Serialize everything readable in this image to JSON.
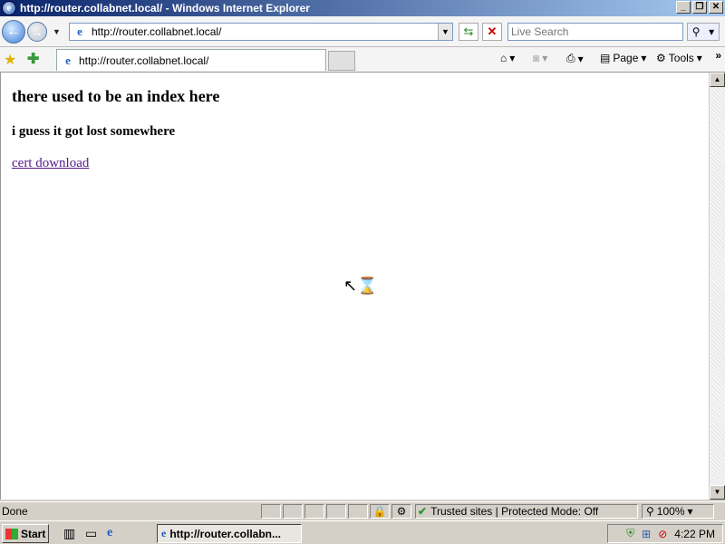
{
  "window": {
    "title": "http://router.collabnet.local/ - Windows Internet Explorer",
    "controls": {
      "minimize": "_",
      "maximize": "❐",
      "close": "✕"
    }
  },
  "navbar": {
    "address": "http://router.collabnet.local/",
    "search_placeholder": "Live Search"
  },
  "tabs": [
    {
      "label": "http://router.collabnet.local/"
    }
  ],
  "command_bar": {
    "page_label": "Page",
    "tools_label": "Tools"
  },
  "page": {
    "heading": "there used to be an index here",
    "subheading": "i guess it got lost somewhere",
    "link_text": "cert download"
  },
  "status_bar": {
    "status": "Done",
    "zone": "Trusted sites | Protected Mode: Off",
    "zoom": "100%"
  },
  "taskbar": {
    "start_label": "Start",
    "task_button_label": "http://router.collabn...",
    "clock": "4:22 PM"
  },
  "colors": {
    "titlebar_start": "#0a246a",
    "titlebar_end": "#a6caf0",
    "visited_link": "#551a8b"
  },
  "icons": [
    "ie-icon",
    "back-icon",
    "forward-icon",
    "refresh-icon",
    "stop-icon",
    "search-icon",
    "favorites-star-icon",
    "add-favorites-icon",
    "home-icon",
    "feeds-icon",
    "print-icon",
    "page-icon",
    "tools-gear-icon",
    "hourglass-cursor-icon",
    "windows-logo-icon",
    "network-icon",
    "security-shield-icon",
    "volume-icon"
  ]
}
